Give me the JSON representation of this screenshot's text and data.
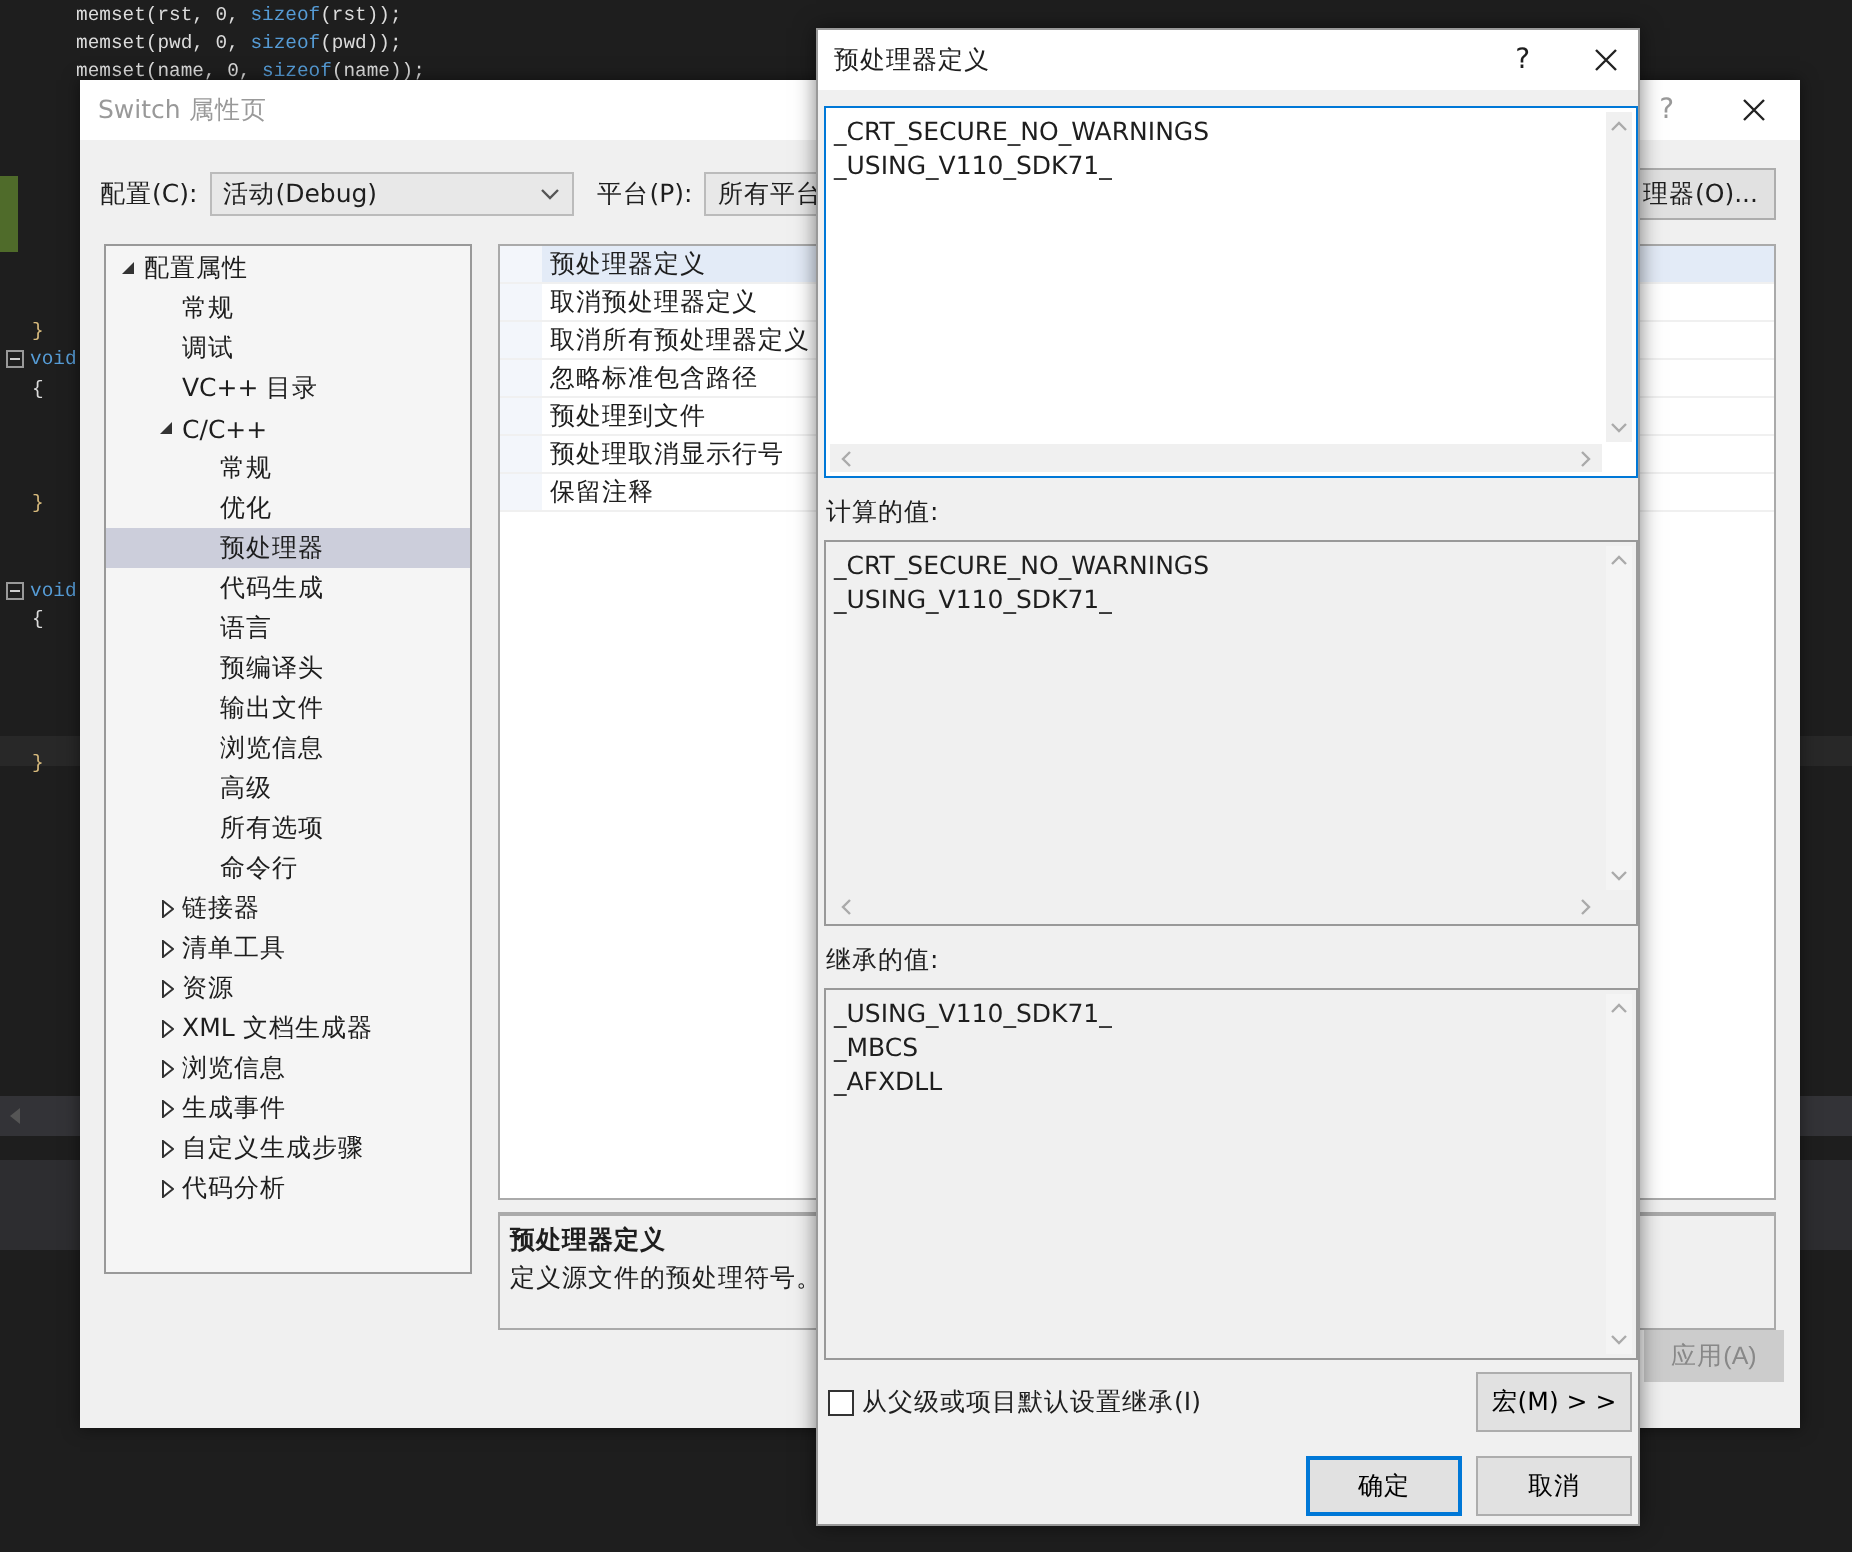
{
  "editor": {
    "lines": [
      {
        "kind": "statement",
        "tokens": [
          {
            "text": "memset(rst, 0, ",
            "kind": "plain"
          },
          {
            "text": "sizeof",
            "kind": "keyword"
          },
          {
            "text": "(rst));",
            "kind": "plain"
          }
        ]
      },
      {
        "kind": "statement",
        "tokens": [
          {
            "text": "memset(pwd, 0, ",
            "kind": "plain"
          },
          {
            "text": "sizeof",
            "kind": "keyword"
          },
          {
            "text": "(pwd));",
            "kind": "plain"
          }
        ]
      },
      {
        "kind": "statement",
        "tokens": [
          {
            "text": "memset(name, 0, ",
            "kind": "plain"
          },
          {
            "text": "sizeof",
            "kind": "keyword"
          },
          {
            "text": "(name));",
            "kind": "plain"
          }
        ]
      },
      {
        "kind": "brace",
        "tokens": [
          {
            "text": "}",
            "kind": "brace"
          }
        ]
      },
      {
        "kind": "decl",
        "expanded": true,
        "tokens": [
          {
            "text": "void",
            "kind": "keyword"
          }
        ]
      },
      {
        "kind": "brace",
        "tokens": [
          {
            "text": "{",
            "kind": "plain"
          }
        ]
      },
      {
        "kind": "brace",
        "tokens": [
          {
            "text": "}",
            "kind": "brace"
          }
        ]
      },
      {
        "kind": "decl",
        "expanded": true,
        "tokens": [
          {
            "text": "void",
            "kind": "keyword"
          }
        ]
      },
      {
        "kind": "brace",
        "tokens": [
          {
            "text": "{",
            "kind": "plain"
          }
        ]
      },
      {
        "kind": "brace",
        "tokens": [
          {
            "text": "}",
            "kind": "brace"
          }
        ]
      }
    ]
  },
  "property_window": {
    "title": "Switch 属性页",
    "help": "?",
    "config_label": "配置(C):",
    "config_value": "活动(Debug)",
    "platform_label": "平台(P):",
    "platform_value": "所有平台",
    "manager_button": "理器(O)...",
    "tree": [
      {
        "label": "配置属性",
        "expanded": true,
        "selected": false,
        "children": [
          {
            "label": "常规",
            "selected": false
          },
          {
            "label": "调试",
            "selected": false
          },
          {
            "label": "VC++ 目录",
            "selected": false
          },
          {
            "label": "C/C++",
            "expanded": true,
            "selected": false,
            "children": [
              {
                "label": "常规",
                "selected": false
              },
              {
                "label": "优化",
                "selected": false
              },
              {
                "label": "预处理器",
                "selected": true
              },
              {
                "label": "代码生成",
                "selected": false
              },
              {
                "label": "语言",
                "selected": false
              },
              {
                "label": "预编译头",
                "selected": false
              },
              {
                "label": "输出文件",
                "selected": false
              },
              {
                "label": "浏览信息",
                "selected": false
              },
              {
                "label": "高级",
                "selected": false
              },
              {
                "label": "所有选项",
                "selected": false
              },
              {
                "label": "命令行",
                "selected": false
              }
            ]
          },
          {
            "label": "链接器",
            "expanded": false,
            "selected": false
          },
          {
            "label": "清单工具",
            "expanded": false,
            "selected": false
          },
          {
            "label": "资源",
            "expanded": false,
            "selected": false
          },
          {
            "label": "XML 文档生成器",
            "expanded": false,
            "selected": false
          },
          {
            "label": "浏览信息",
            "expanded": false,
            "selected": false
          },
          {
            "label": "生成事件",
            "expanded": false,
            "selected": false
          },
          {
            "label": "自定义生成步骤",
            "expanded": false,
            "selected": false
          },
          {
            "label": "代码分析",
            "expanded": false,
            "selected": false
          }
        ]
      }
    ],
    "properties": [
      {
        "name": "预处理器定义",
        "selected": true
      },
      {
        "name": "取消预处理器定义",
        "selected": false
      },
      {
        "name": "取消所有预处理器定义",
        "selected": false
      },
      {
        "name": "忽略标准包含路径",
        "selected": false
      },
      {
        "name": "预处理到文件",
        "selected": false
      },
      {
        "name": "预处理取消显示行号",
        "selected": false
      },
      {
        "name": "保留注释",
        "selected": false
      }
    ],
    "description": {
      "title": "预处理器定义",
      "text": "定义源文件的预处理符号。"
    },
    "apply_button": {
      "label": "应用(A)",
      "disabled": true
    }
  },
  "dialog": {
    "title": "预处理器定义",
    "help": "?",
    "definitions": [
      "_CRT_SECURE_NO_WARNINGS",
      "_USING_V110_SDK71_"
    ],
    "evaluated_label": "计算的值:",
    "evaluated": [
      "_CRT_SECURE_NO_WARNINGS",
      "_USING_V110_SDK71_"
    ],
    "inherited_label": "继承的值:",
    "inherited": [
      "_USING_V110_SDK71_",
      "_MBCS",
      "_AFXDLL"
    ],
    "inherit_checkbox": {
      "label": "从父级或项目默认设置继承(I)",
      "checked": false
    },
    "macros_button": "宏(M) > >",
    "ok_button": "确定",
    "cancel_button": "取消"
  }
}
